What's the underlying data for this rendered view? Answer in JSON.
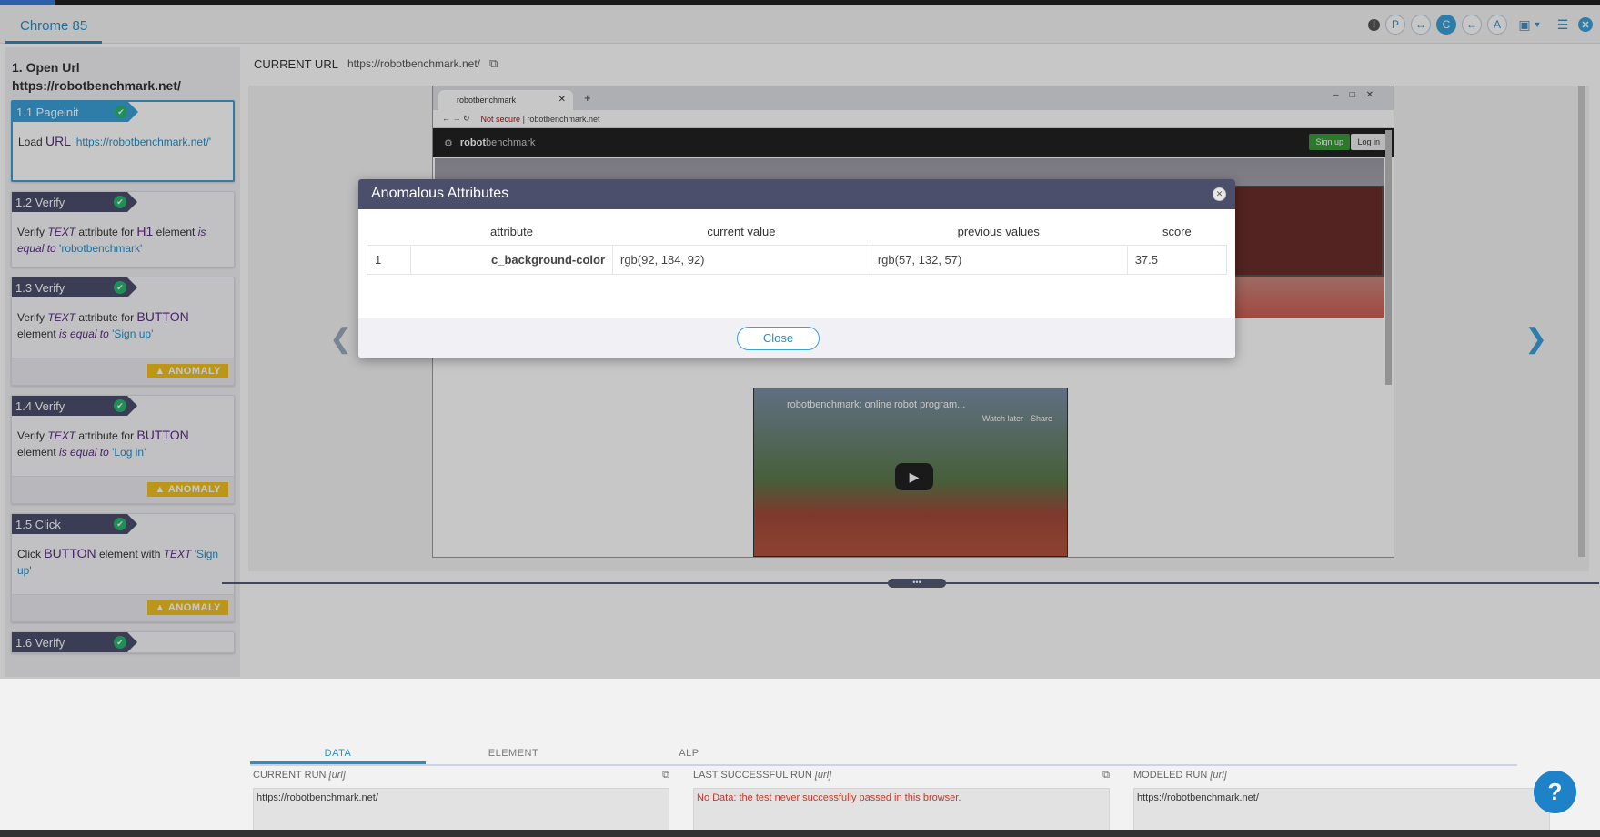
{
  "app": {
    "browser_tab": "Chrome 85",
    "toolbar": {
      "p": "P",
      "c": "C",
      "a": "A",
      "arrows": "↔"
    }
  },
  "steps": {
    "group_title_line1": "1. Open Url",
    "group_title_line2": "https://robotbenchmark.net/",
    "items": [
      {
        "label": "1.1 Pageinit",
        "pre": "Load",
        "kw": "URL",
        "str": "'https://robotbenchmark.net/'"
      },
      {
        "label": "1.2 Verify",
        "pre": "Verify",
        "it1": "TEXT",
        "mid": "attribute for",
        "kw": "H1",
        "post": "element",
        "it2": "is equal to",
        "str": "'robotbenchmark'"
      },
      {
        "label": "1.3 Verify",
        "pre": "Verify",
        "it1": "TEXT",
        "mid": "attribute for",
        "kw": "BUTTON",
        "post": "element",
        "it2": "is equal to",
        "str": "'Sign up'",
        "badge": "ANOMALY"
      },
      {
        "label": "1.4 Verify",
        "pre": "Verify",
        "it1": "TEXT",
        "mid": "attribute for",
        "kw": "BUTTON",
        "post": "element",
        "it2": "is equal to",
        "str": "'Log in'",
        "badge": "ANOMALY"
      },
      {
        "label": "1.5 Click",
        "pre": "Click",
        "kw": "BUTTON",
        "post": "element with",
        "it1": "TEXT",
        "str": "'Sign up'",
        "badge": "ANOMALY"
      },
      {
        "label": "1.6 Verify"
      }
    ]
  },
  "current_url": {
    "label": "CURRENT URL",
    "value": "https://robotbenchmark.net/"
  },
  "screenshot": {
    "tab_title": "robotbenchmark",
    "not_secure": "Not secure",
    "address": "robotbenchmark.net",
    "site_brand_bold": "robot",
    "site_brand_rest": "benchmark",
    "signup": "Sign up",
    "login": "Log in",
    "video_title": "robotbenchmark: online robot program...",
    "watch_later": "Watch later",
    "share": "Share"
  },
  "modal": {
    "title": "Anomalous Attributes",
    "columns": [
      "attribute",
      "current value",
      "previous values",
      "score"
    ],
    "rows": [
      {
        "index": "1",
        "attribute": "c_background-color",
        "current": "rgb(92, 184, 92)",
        "previous": "rgb(57, 132, 57)",
        "score": "37.5"
      }
    ],
    "close_label": "Close"
  },
  "bottom": {
    "tabs": [
      "DATA",
      "ELEMENT",
      "ALP"
    ],
    "current_run": {
      "title": "CURRENT RUN",
      "tag": "[url]",
      "value": "https://robotbenchmark.net/"
    },
    "last_run": {
      "title": "LAST SUCCESSFUL RUN",
      "tag": "[url]",
      "value": "No Data: the test never successfully passed in this browser."
    },
    "modeled_run": {
      "title": "MODELED RUN",
      "tag": "[url]",
      "value": "https://robotbenchmark.net/"
    }
  },
  "help": "?",
  "colors": {
    "accent": "#3aa0d8",
    "header_dark": "#4b4f6c",
    "anomaly": "#f0c020",
    "pass": "#2bb673"
  }
}
